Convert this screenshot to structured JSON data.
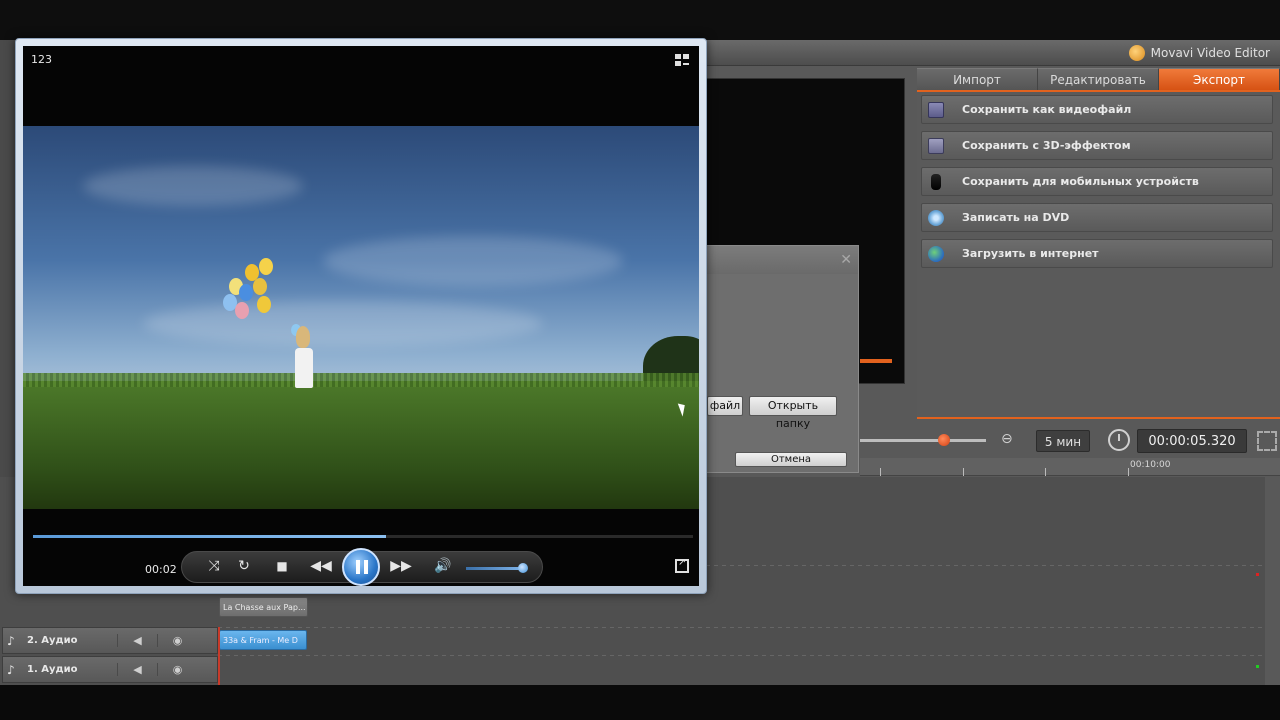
{
  "app": {
    "title": "Movavi Video Editor"
  },
  "tabs": [
    {
      "label": "Импорт"
    },
    {
      "label": "Редактировать"
    },
    {
      "label": "Экспорт",
      "active": true
    }
  ],
  "export_actions": [
    {
      "label": "Сохранить как видеофайл",
      "icon": "film-icon"
    },
    {
      "label": "Сохранить с 3D-эффектом",
      "icon": "3d-icon"
    },
    {
      "label": "Сохранить для мобильных устройств",
      "icon": "phone-icon"
    },
    {
      "label": "Записать на DVD",
      "icon": "dvd-icon"
    },
    {
      "label": "Загрузить в интернет",
      "icon": "globe-icon"
    }
  ],
  "dialog": {
    "file_button": "файл",
    "open_folder_button": "Открыть папку",
    "cancel_button": "Отмена"
  },
  "timeline": {
    "zoom_label": "5 мин",
    "timecode": "00:00:05.320",
    "ruler_label": "00:10:00",
    "tracks": [
      {
        "name": "2. Аудио",
        "clip": "33a & Fram - Me D"
      },
      {
        "name": "1. Аудио"
      }
    ],
    "video_clip": "La Chasse aux Pap..."
  },
  "player": {
    "title": "123",
    "current_time": "00:02",
    "seek_progress": 0.535,
    "volume": 0.9
  },
  "colors": {
    "accent": "#e2621e",
    "player_blue": "#2a76c8"
  }
}
